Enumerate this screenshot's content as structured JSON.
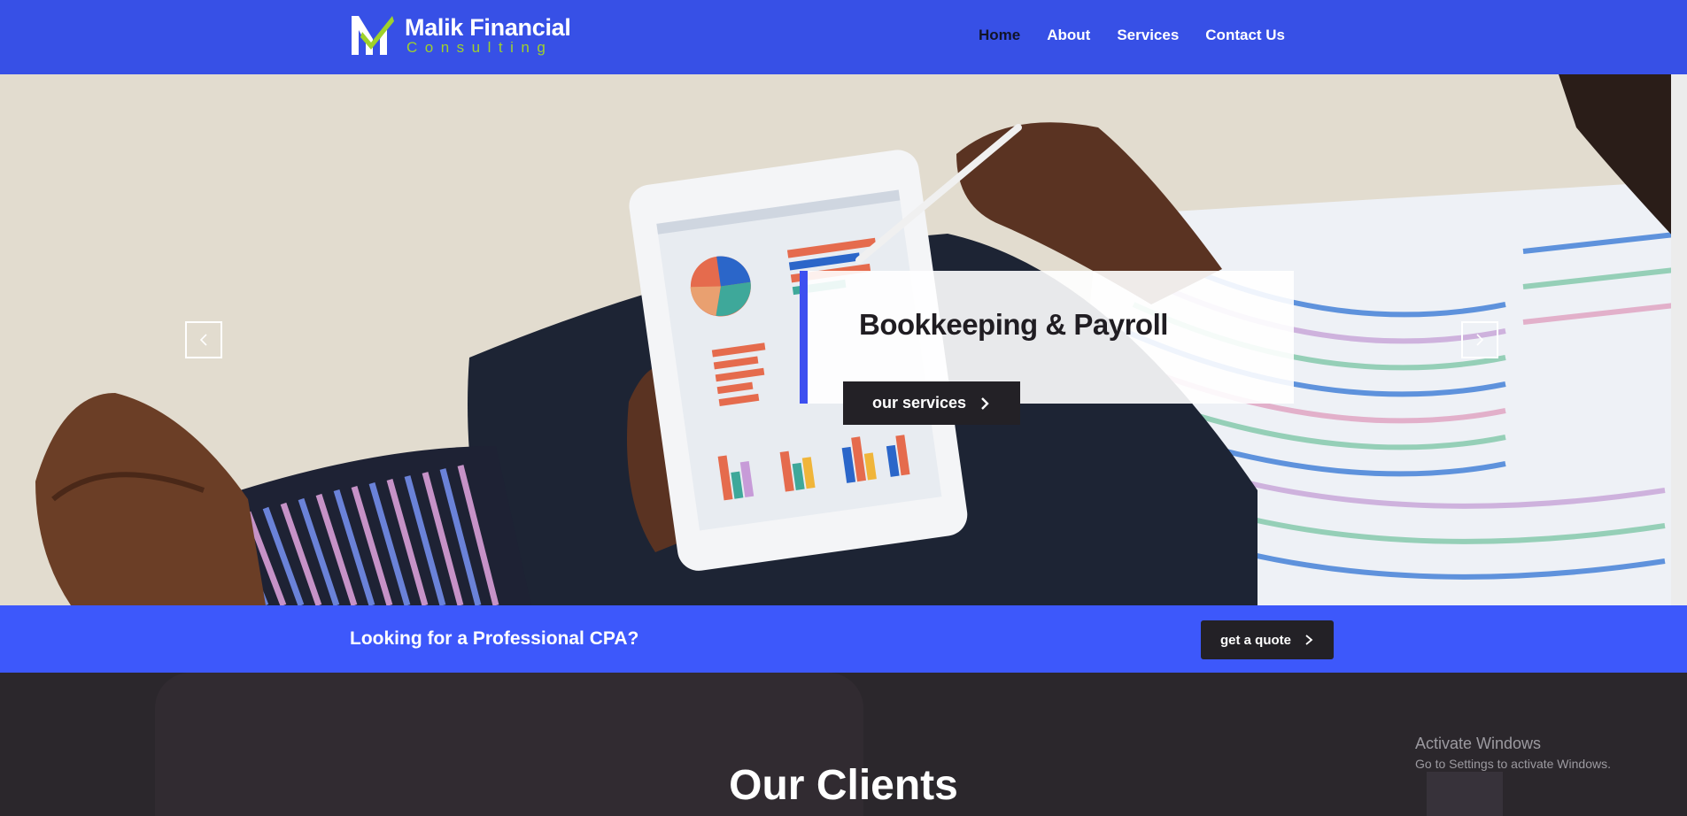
{
  "brand": {
    "name": "Malik Financial",
    "tagline": "Consulting",
    "colors": {
      "primary": "#3750e6",
      "accent_green": "#9fd12b",
      "dark": "#232126",
      "cta_band": "#3d58fb"
    }
  },
  "nav": {
    "items": [
      {
        "label": "Home",
        "active": true
      },
      {
        "label": "About",
        "active": false
      },
      {
        "label": "Services",
        "active": false
      },
      {
        "label": "Contact Us",
        "active": false
      }
    ]
  },
  "hero": {
    "title": "Bookkeeping & Payroll",
    "button_label": "our services",
    "prev_icon": "chevron-left-icon",
    "next_icon": "chevron-right-icon"
  },
  "cta": {
    "text": "Looking for a Professional CPA?",
    "button_label": "get a quote"
  },
  "clients": {
    "title": "Our Clients"
  },
  "watermark": {
    "title": "Activate Windows",
    "subtitle": "Go to Settings to activate Windows."
  }
}
